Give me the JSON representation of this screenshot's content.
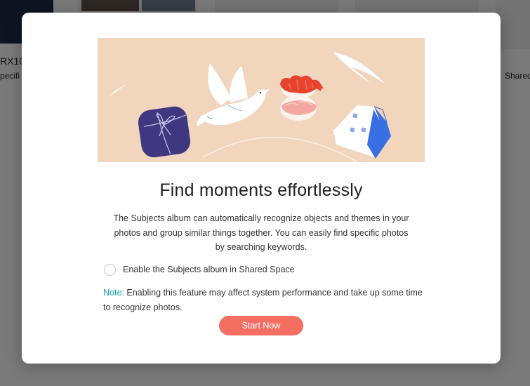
{
  "background": {
    "item_left_title": "RX10",
    "item_left_subtitle": "pecifi",
    "item_right_subtitle": "Shared"
  },
  "dialog": {
    "title": "Find moments effortlessly",
    "description": "The Subjects album can automatically recognize objects and themes in your photos and group similar things together. You can easily find specific photos by searching keywords.",
    "checkbox_label": "Enable the Subjects album in Shared Space",
    "checkbox_checked": false,
    "note_prefix": "Note:",
    "note_text": " Enabling this feature may affect system performance and take up some time to recognize photos.",
    "start_button_label": "Start Now",
    "illustration_icons": [
      "gift-icon",
      "dove-icon",
      "sushi-icon",
      "house-icon"
    ]
  },
  "colors": {
    "accent_button": "#f46e62",
    "note_prefix": "#17a8b0",
    "illustration_bg": "#f1d5bd"
  }
}
